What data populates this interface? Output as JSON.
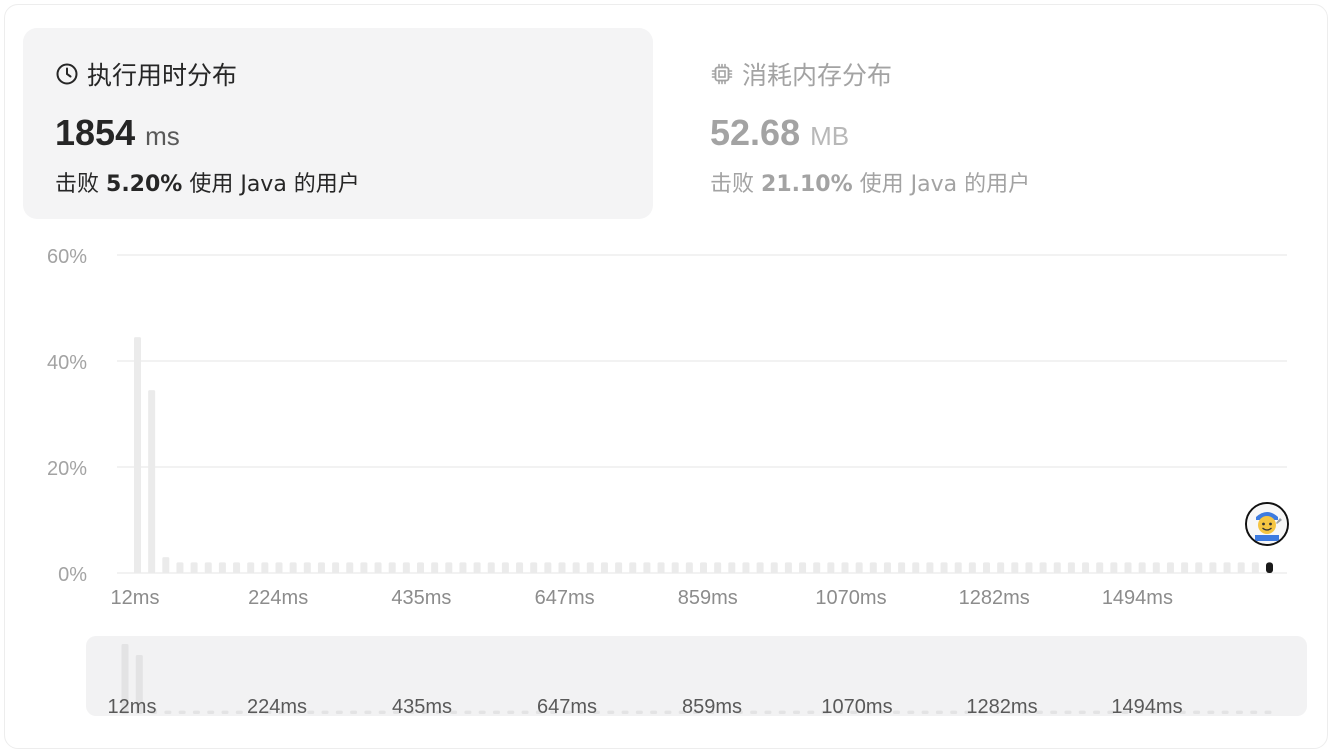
{
  "runtime_card": {
    "title": "执行用时分布",
    "icon": "clock-icon",
    "value": "1854",
    "unit": "ms",
    "beats_prefix": "击败",
    "beats_pct": "5.20%",
    "beats_suffix": "使用 Java 的用户"
  },
  "memory_card": {
    "title": "消耗内存分布",
    "icon": "chip-icon",
    "value": "52.68",
    "unit": "MB",
    "beats_prefix": "击败",
    "beats_pct": "21.10%",
    "beats_suffix": "使用 Java 的用户"
  },
  "colors": {
    "bar": "#ebebeb",
    "bar_highlight": "#1a1a1a",
    "grid": "#e6e6e6",
    "axis_text": "#a3a3a3",
    "x_text": "#8c8c8c"
  },
  "chart_data": {
    "type": "bar",
    "y_ticks": [
      "60%",
      "40%",
      "20%",
      "0%"
    ],
    "ylim": [
      0,
      60
    ],
    "x_tick_labels": [
      "12ms",
      "224ms",
      "435ms",
      "647ms",
      "859ms",
      "1070ms",
      "1282ms",
      "1494ms"
    ],
    "bin_count": 81,
    "values": [
      44.5,
      34.5,
      3.0,
      2.0,
      2.0,
      2.0,
      2.0,
      2.0,
      2.0,
      2.0,
      2.0,
      2.0,
      2.0,
      2.0,
      2.0,
      2.0,
      2.0,
      2.0,
      2.0,
      2.0,
      2.0,
      2.0,
      2.0,
      2.0,
      2.0,
      2.0,
      2.0,
      2.0,
      2.0,
      2.0,
      2.0,
      2.0,
      2.0,
      2.0,
      2.0,
      2.0,
      2.0,
      2.0,
      2.0,
      2.0,
      2.0,
      2.0,
      2.0,
      2.0,
      2.0,
      2.0,
      2.0,
      2.0,
      2.0,
      2.0,
      2.0,
      2.0,
      2.0,
      2.0,
      2.0,
      2.0,
      2.0,
      2.0,
      2.0,
      2.0,
      2.0,
      2.0,
      2.0,
      2.0,
      2.0,
      2.0,
      2.0,
      2.0,
      2.0,
      2.0,
      2.0,
      2.0,
      2.0,
      2.0,
      2.0,
      2.0,
      2.0,
      2.0,
      2.0,
      2.0,
      2.0
    ],
    "highlight_index": 80,
    "highlight_value": 2.0,
    "grid": true
  },
  "navigator": {
    "x_tick_labels": [
      "12ms",
      "224ms",
      "435ms",
      "647ms",
      "859ms",
      "1070ms",
      "1282ms",
      "1494ms"
    ]
  },
  "avatar": {
    "icon": "user-avatar-icon"
  }
}
